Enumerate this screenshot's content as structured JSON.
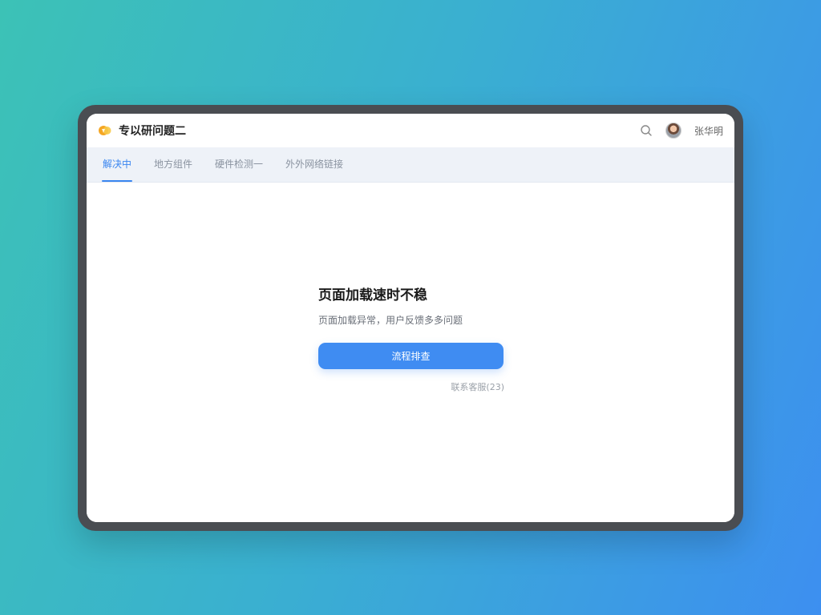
{
  "app": {
    "title": "专以研问题二",
    "user_name": "张华明"
  },
  "tabs": [
    {
      "label": "解决中",
      "active": true
    },
    {
      "label": "地方组件",
      "active": false
    },
    {
      "label": "硬件检测一",
      "active": false
    },
    {
      "label": "外外网络链接",
      "active": false
    }
  ],
  "main": {
    "headline": "页面加载速时不稳",
    "subtext": "页面加载异常，用户反馈多多问题",
    "primary_button": "流程排查",
    "secondary_link": "联系客服(23)"
  },
  "colors": {
    "accent": "#3a86f0",
    "bg_gradient_start": "#3cc2b6",
    "bg_gradient_end": "#3d8ff0"
  },
  "icons": {
    "logo": "app-logo-icon",
    "search": "search-icon",
    "avatar": "user-avatar"
  }
}
